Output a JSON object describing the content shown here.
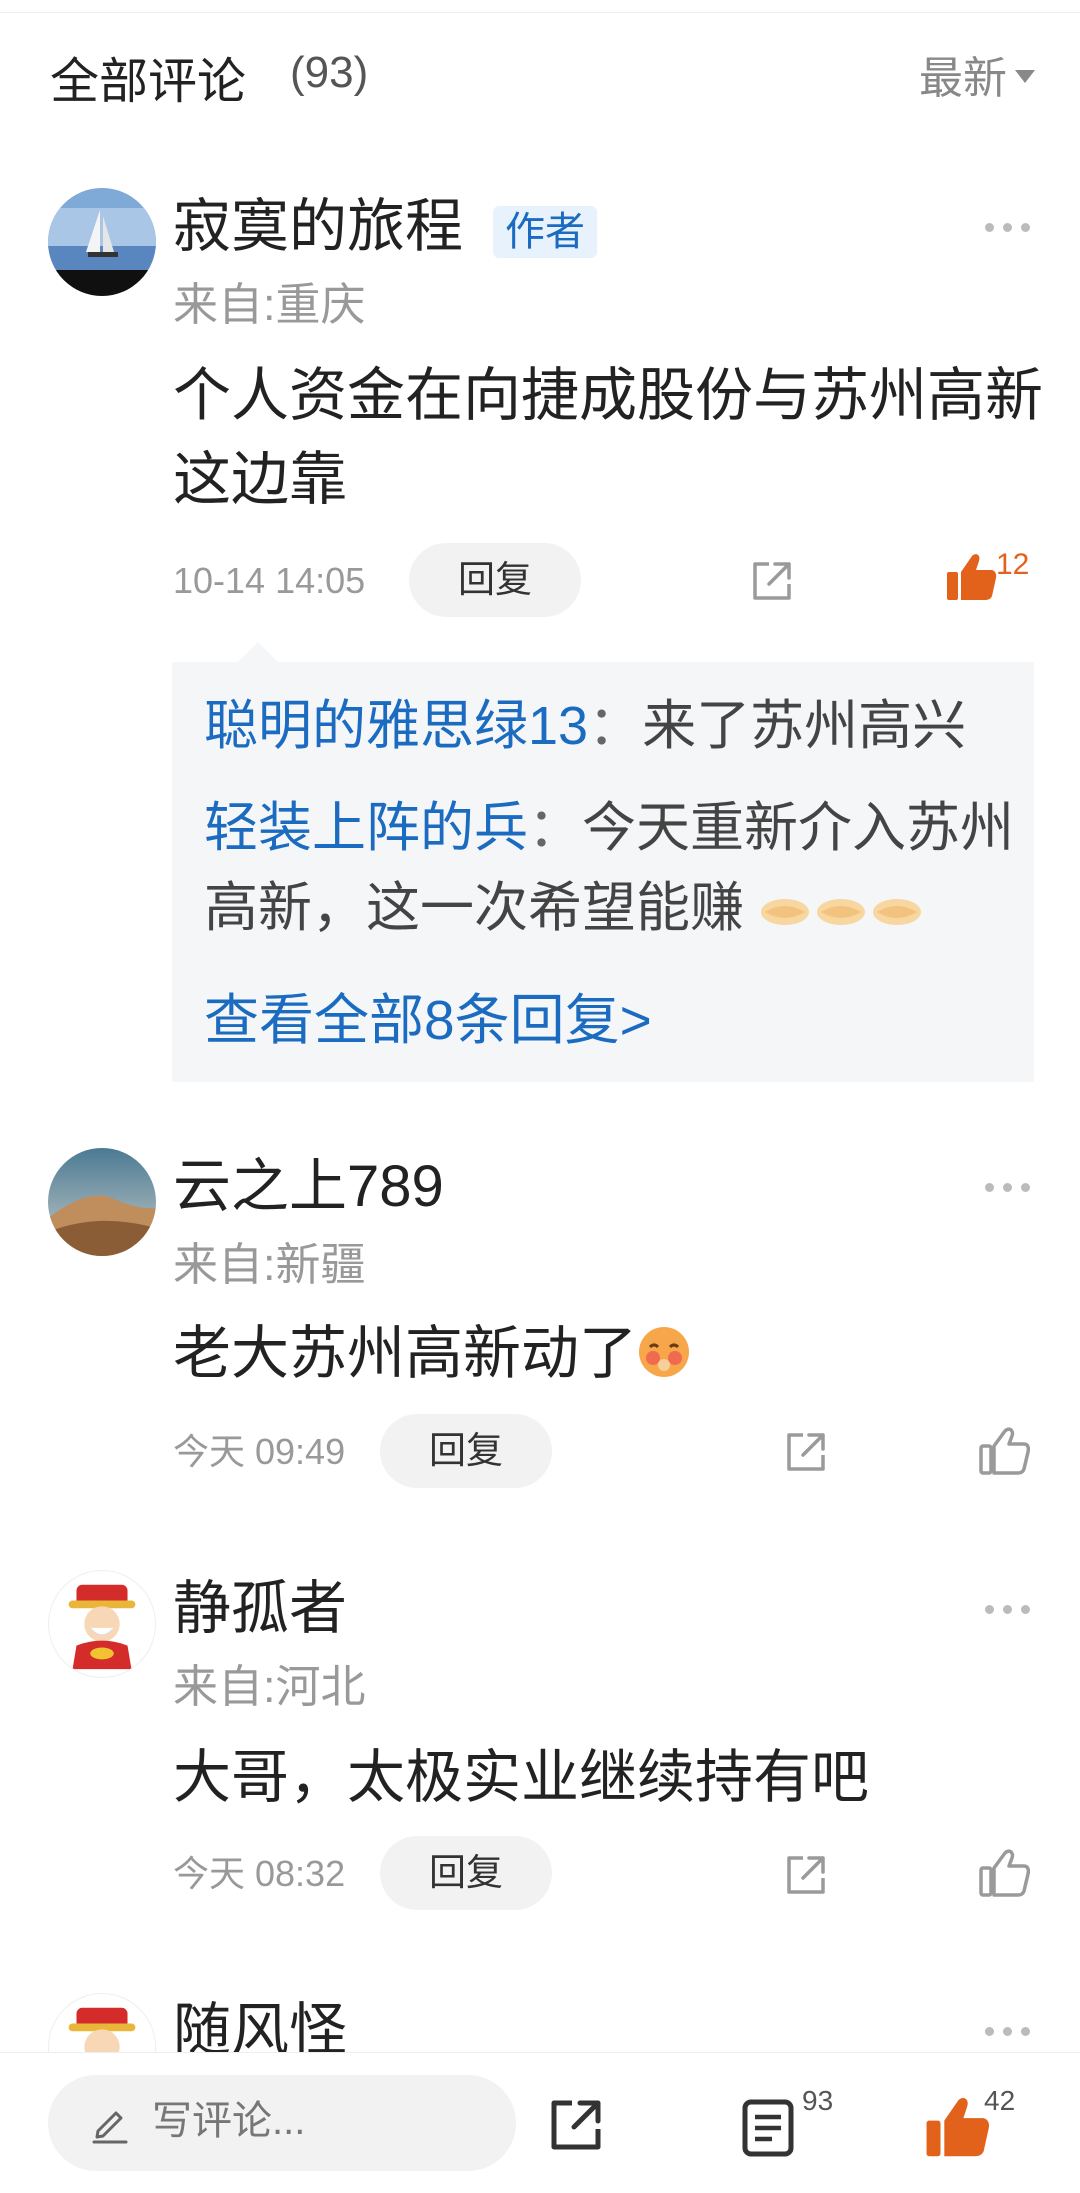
{
  "header": {
    "title": "全部评论",
    "count": "(93)",
    "sort_label": "最新"
  },
  "comments": [
    {
      "username": "寂寞的旅程",
      "badge": "作者",
      "location": "来自:重庆",
      "text": "个人资金在向捷成股份与苏州高新这边靠",
      "time": "10-14 14:05",
      "reply_label": "回复",
      "like_count": "12",
      "liked": true,
      "replies": [
        {
          "name": "聪明的雅思绿13",
          "sep": "：",
          "text": "来了苏州高兴"
        },
        {
          "name": "轻装上阵的兵",
          "sep": "：",
          "text": "今天重新介入苏州高新，这一次希望能赚"
        }
      ],
      "view_all": "查看全部8条回复>"
    },
    {
      "username": "云之上789",
      "location": "来自:新疆",
      "text": "老大苏州高新动了",
      "time": "今天 09:49",
      "reply_label": "回复",
      "like_count": ""
    },
    {
      "username": "静孤者",
      "location": "来自:河北",
      "text": "大哥，太极实业继续持有吧",
      "time": "今天 08:32",
      "reply_label": "回复",
      "like_count": ""
    },
    {
      "username": "随风怪"
    }
  ],
  "bottom_bar": {
    "write_placeholder": "写评论...",
    "comment_count": "93",
    "like_count": "42"
  },
  "colors": {
    "accent": "#e2621c",
    "link": "#1b6bc0",
    "muted": "#999999"
  },
  "icons": [
    "chevron-down-icon",
    "more-icon",
    "share-icon",
    "thumbs-up-icon",
    "pencil-icon",
    "comment-list-icon",
    "handshake-emoji",
    "blushing-emoji"
  ]
}
